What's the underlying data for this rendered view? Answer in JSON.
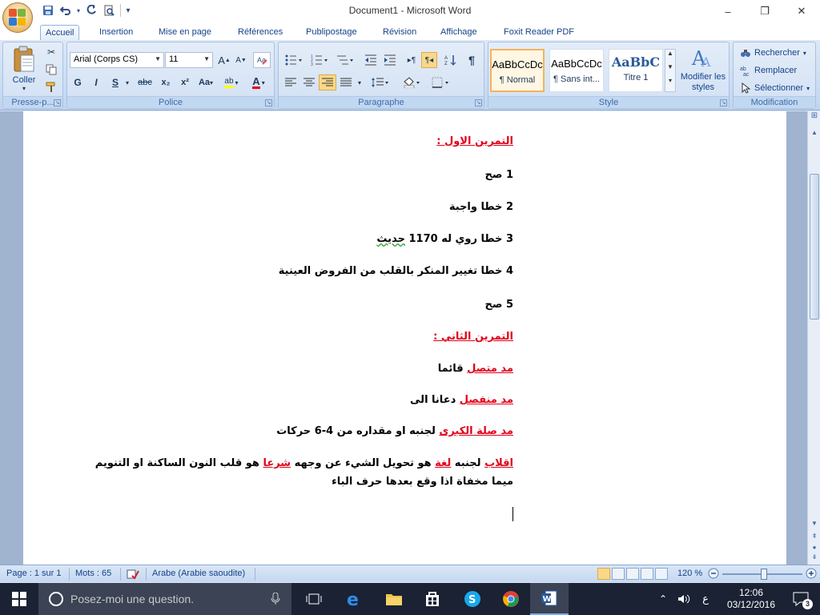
{
  "window": {
    "title": "Document1 - Microsoft Word",
    "controls": {
      "minimize": "–",
      "maximize": "❐",
      "close": "✕"
    }
  },
  "qat": {
    "save": "💾",
    "undo": "↶",
    "redo": "↻",
    "preview": "🔍",
    "customize": "▾"
  },
  "tabs": [
    {
      "label": "Accueil",
      "active": true
    },
    {
      "label": "Insertion"
    },
    {
      "label": "Mise en page"
    },
    {
      "label": "Références"
    },
    {
      "label": "Publipostage"
    },
    {
      "label": "Révision"
    },
    {
      "label": "Affichage"
    },
    {
      "label": "Foxit Reader PDF"
    }
  ],
  "ribbon": {
    "clipboard": {
      "label": "Presse-p...",
      "paste": "Coller"
    },
    "font": {
      "label": "Police",
      "name": "Arial (Corps CS)",
      "size": "11",
      "grow": "A",
      "shrink": "A",
      "bold": "G",
      "italic": "I",
      "underline": "S",
      "strike": "abc",
      "subscript": "x₂",
      "superscript": "x²",
      "case": "Aa",
      "highlight": "ab",
      "color": "A"
    },
    "paragraph": {
      "label": "Paragraphe"
    },
    "styles": {
      "label": "Style",
      "items": [
        {
          "preview": "AaBbCcDc",
          "name": "¶ Normal",
          "selected": true
        },
        {
          "preview": "AaBbCcDc",
          "name": "¶ Sans int..."
        },
        {
          "preview": "AaBbC",
          "name": "Titre 1"
        }
      ],
      "change": "Modifier les styles"
    },
    "editing": {
      "label": "Modification",
      "find": "Rechercher",
      "replace": "Remplacer",
      "select": "Sélectionner"
    }
  },
  "document": {
    "ex1_title": "التمرين الاول :",
    "ex1": [
      {
        "num": "1",
        "text": "صح"
      },
      {
        "num": "2",
        "text": "خطا واجبة"
      },
      {
        "num": "3",
        "text_a": "خطا روي له ",
        "number": "1170",
        "text_b": "حديث"
      },
      {
        "num": "4",
        "text": "خطا تغيير المنكر بالقلب من الفروض العينية"
      },
      {
        "num": "5",
        "text": "صح"
      }
    ],
    "ex2_title": "التمرين الثاني :",
    "ex2": [
      {
        "term": "مد متصل",
        "example": "قائما"
      },
      {
        "term": "مد منفصل",
        "example": "دعانا الى"
      },
      {
        "term": "مد صلة الكبرى",
        "example": "لجنبه او  مقداره من 4-6 حركات"
      }
    ],
    "iqlab": {
      "word1": "اقلاب",
      "part1": "لجنبه  ",
      "word2": "لغة",
      "part2": " هو تحويل الشيء عن وجهه ",
      "word3": "شرعا",
      "part3": " هو قلب النون الساكنة او التنويم",
      "line2": "ميما مخفاة اذا وقع بعدها حرف الباء"
    }
  },
  "statusbar": {
    "page": "Page : 1 sur 1",
    "words": "Mots : 65",
    "language": "Arabe (Arabie saoudite)",
    "zoom": "120 %"
  },
  "taskbar": {
    "search_placeholder": "Posez-moi une question.",
    "input_lang": "ع",
    "time": "12:06",
    "date": "03/12/2016",
    "notifications": "3"
  }
}
